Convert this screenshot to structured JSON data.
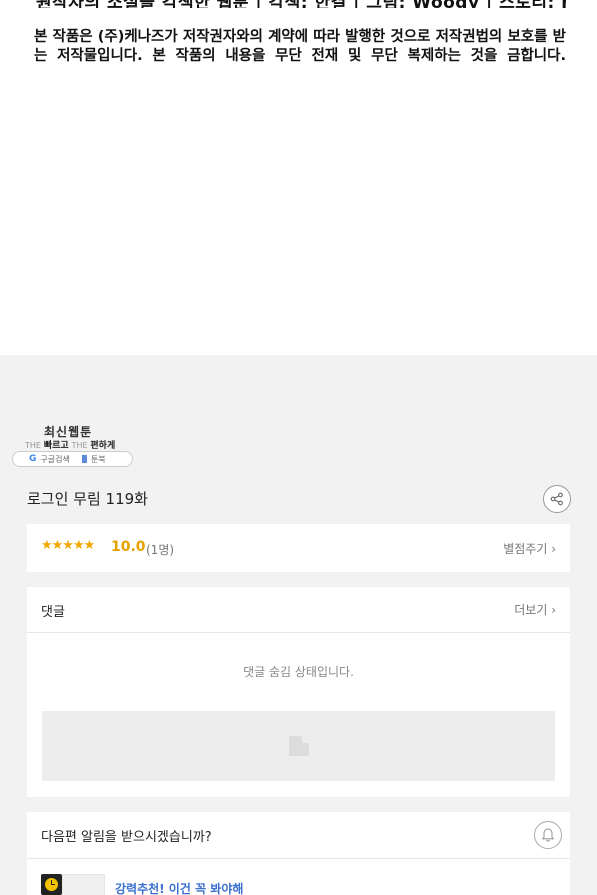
{
  "comic": {
    "cut_text": "원작자의 소설을 각색한 웹툰 | 각색: 한결 | 그림: Woody | 스토리: name,jingoo",
    "notice": "본 작품은 (주)케나즈가 저작권자와의 계약에 따라 발행한 것으로 저작권법의 보호를 받는 저작물입니다. 본 작품의 내용을 무단 전재 및 무단 복제하는 것을 금합니다."
  },
  "badge": {
    "title": "최신웹툰",
    "the1": "THE",
    "fast": "빠르고",
    "the2": "THE",
    "easy": "편하게",
    "google_glyph": "G",
    "google_label": "구글검색",
    "toonbook_label": "툰북"
  },
  "episode": {
    "title": "로그인 무림 119화"
  },
  "rating": {
    "stars": "★★★★★",
    "score": "10.0",
    "count": "(1명)",
    "rate_link": "별점주기 ›"
  },
  "comments": {
    "title": "댓글",
    "more": "더보기 ›",
    "hidden_message": "댓글 숨김 상태입니다."
  },
  "notify": {
    "question": "다음편 알림을 받으시겠습니까?",
    "recommend_text": "강력추천! 이건 꼭 봐야해"
  },
  "icons": [
    "share-icon",
    "bell-icon",
    "clock-icon",
    "image-placeholder-icon",
    "google-icon",
    "book-icon"
  ],
  "colors": {
    "star": "#f0a800",
    "score": "#e8a000",
    "link_blue": "#3a6fd0",
    "background_grey": "#f2f2f2"
  }
}
